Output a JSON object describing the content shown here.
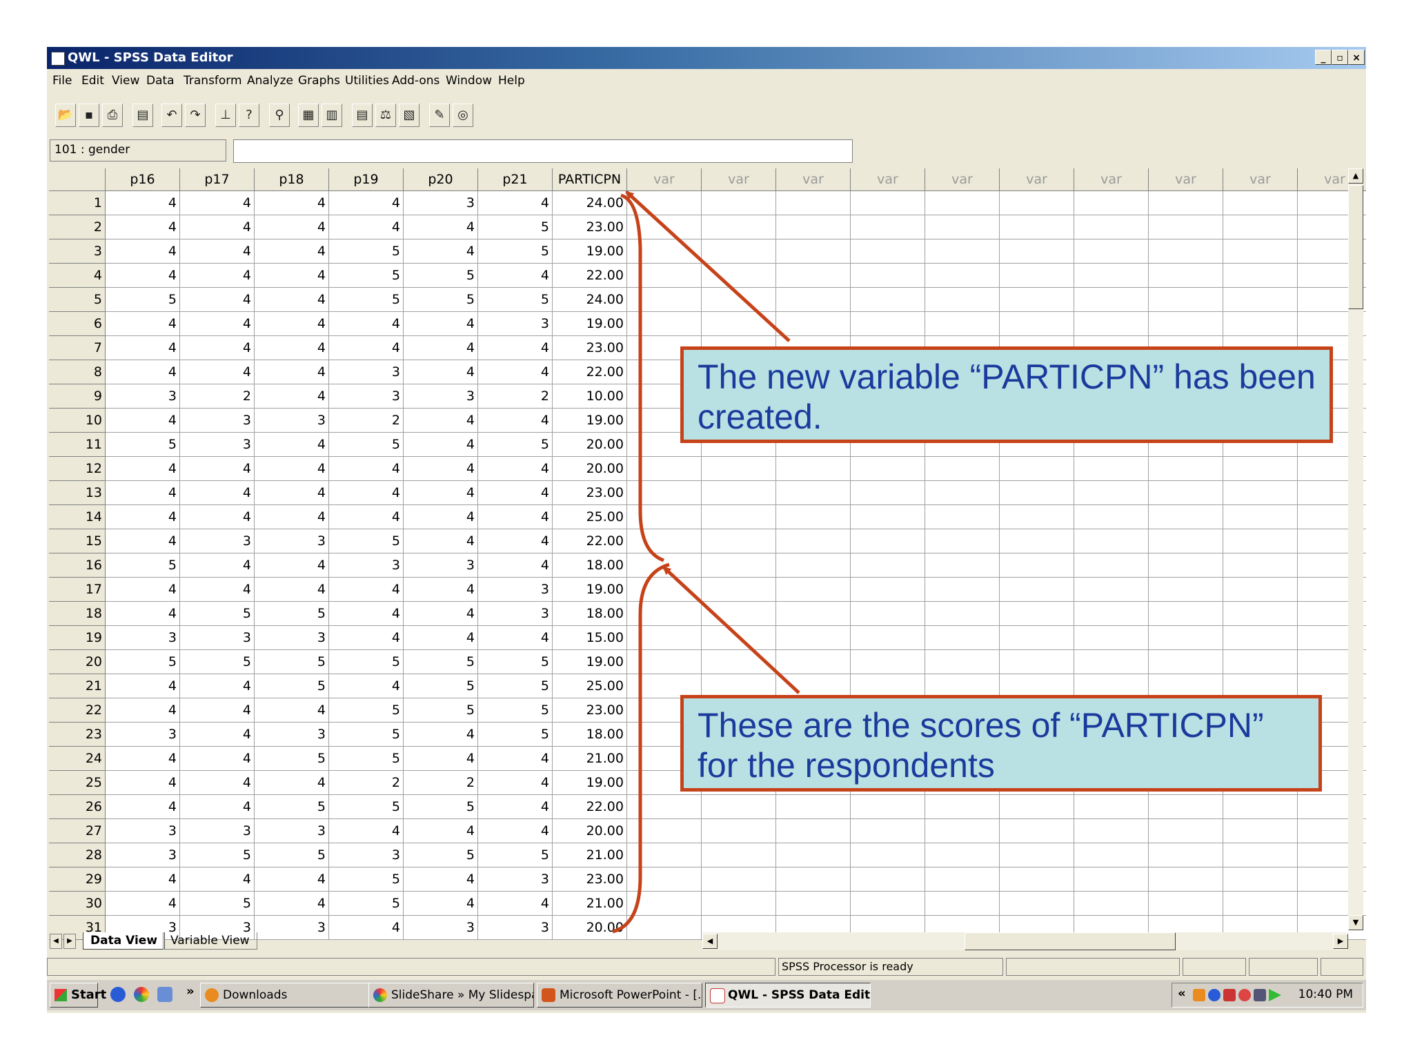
{
  "window": {
    "title": "QWL - SPSS Data Editor",
    "min_label": "_",
    "max_label": "▫",
    "close_label": "×"
  },
  "menu": [
    "File",
    "Edit",
    "View",
    "Data",
    "Transform",
    "Analyze",
    "Graphs",
    "Utilities",
    "Add-ons",
    "Window",
    "Help"
  ],
  "cell_editor": {
    "ref": "101 : gender",
    "value": ""
  },
  "columns": [
    "p16",
    "p17",
    "p18",
    "p19",
    "p20",
    "p21",
    "PARTICPN",
    "var",
    "var",
    "var",
    "var",
    "var",
    "var",
    "var",
    "var",
    "var",
    "var"
  ],
  "rows": [
    [
      "1",
      "4",
      "4",
      "4",
      "4",
      "3",
      "4",
      "24.00"
    ],
    [
      "2",
      "4",
      "4",
      "4",
      "4",
      "4",
      "5",
      "23.00"
    ],
    [
      "3",
      "4",
      "4",
      "4",
      "5",
      "4",
      "5",
      "19.00"
    ],
    [
      "4",
      "4",
      "4",
      "4",
      "5",
      "5",
      "4",
      "22.00"
    ],
    [
      "5",
      "5",
      "4",
      "4",
      "5",
      "5",
      "5",
      "24.00"
    ],
    [
      "6",
      "4",
      "4",
      "4",
      "4",
      "4",
      "3",
      "19.00"
    ],
    [
      "7",
      "4",
      "4",
      "4",
      "4",
      "4",
      "4",
      "23.00"
    ],
    [
      "8",
      "4",
      "4",
      "4",
      "3",
      "4",
      "4",
      "22.00"
    ],
    [
      "9",
      "3",
      "2",
      "4",
      "3",
      "3",
      "2",
      "10.00"
    ],
    [
      "10",
      "4",
      "3",
      "3",
      "2",
      "4",
      "4",
      "19.00"
    ],
    [
      "11",
      "5",
      "3",
      "4",
      "5",
      "4",
      "5",
      "20.00"
    ],
    [
      "12",
      "4",
      "4",
      "4",
      "4",
      "4",
      "4",
      "20.00"
    ],
    [
      "13",
      "4",
      "4",
      "4",
      "4",
      "4",
      "4",
      "23.00"
    ],
    [
      "14",
      "4",
      "4",
      "4",
      "4",
      "4",
      "4",
      "25.00"
    ],
    [
      "15",
      "4",
      "3",
      "3",
      "5",
      "4",
      "4",
      "22.00"
    ],
    [
      "16",
      "5",
      "4",
      "4",
      "3",
      "3",
      "4",
      "18.00"
    ],
    [
      "17",
      "4",
      "4",
      "4",
      "4",
      "4",
      "3",
      "19.00"
    ],
    [
      "18",
      "4",
      "5",
      "5",
      "4",
      "4",
      "3",
      "18.00"
    ],
    [
      "19",
      "3",
      "3",
      "3",
      "4",
      "4",
      "4",
      "15.00"
    ],
    [
      "20",
      "5",
      "5",
      "5",
      "5",
      "5",
      "5",
      "19.00"
    ],
    [
      "21",
      "4",
      "4",
      "5",
      "4",
      "5",
      "5",
      "25.00"
    ],
    [
      "22",
      "4",
      "4",
      "4",
      "5",
      "5",
      "5",
      "23.00"
    ],
    [
      "23",
      "3",
      "4",
      "3",
      "5",
      "4",
      "5",
      "18.00"
    ],
    [
      "24",
      "4",
      "4",
      "5",
      "5",
      "4",
      "4",
      "21.00"
    ],
    [
      "25",
      "4",
      "4",
      "4",
      "2",
      "2",
      "4",
      "19.00"
    ],
    [
      "26",
      "4",
      "4",
      "5",
      "5",
      "5",
      "4",
      "22.00"
    ],
    [
      "27",
      "3",
      "3",
      "3",
      "4",
      "4",
      "4",
      "20.00"
    ],
    [
      "28",
      "3",
      "5",
      "5",
      "3",
      "5",
      "5",
      "21.00"
    ],
    [
      "29",
      "4",
      "4",
      "4",
      "5",
      "4",
      "3",
      "23.00"
    ],
    [
      "30",
      "4",
      "5",
      "4",
      "5",
      "4",
      "4",
      "21.00"
    ],
    [
      "31",
      "3",
      "3",
      "3",
      "4",
      "3",
      "3",
      "20.00"
    ]
  ],
  "tabs": {
    "data_view": "Data View",
    "variable_view": "Variable View"
  },
  "status": {
    "processor": "SPSS Processor  is ready"
  },
  "taskbar": {
    "start": "Start",
    "overflow": "»",
    "items": [
      "Downloads",
      "SlideShare » My Slidespa...",
      "Microsoft PowerPoint - [...",
      "QWL - SPSS Data Editor"
    ],
    "tray_chevron": "«",
    "clock": "10:40 PM"
  },
  "callouts": {
    "top": "The new variable “PARTICPN” has been created.",
    "bottom": "These are the scores of “PARTICPN” for the respondents"
  },
  "colors": {
    "callout_fill": "#b9e0e3",
    "callout_border": "#c6431a",
    "callout_text": "#1a3a9c",
    "arrow": "#c6431a"
  }
}
